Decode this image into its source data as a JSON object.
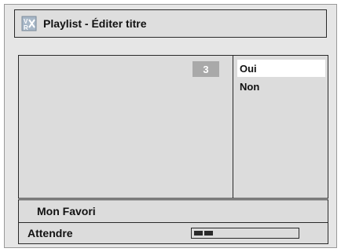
{
  "window": {
    "title": "Playlist - Éditer titre",
    "icon": "playlist-edit-icon"
  },
  "preview": {
    "counter": "3"
  },
  "menu": {
    "items": [
      {
        "label": "Oui",
        "selected": true
      },
      {
        "label": "Non",
        "selected": false
      }
    ]
  },
  "favorite": {
    "label": "Mon Favori"
  },
  "status": {
    "label": "Attendre",
    "progress": 0.18
  },
  "colors": {
    "background": "#e6e6e6",
    "panel": "#dcdcdc",
    "counter_bg": "#a9a9a9",
    "selected_bg": "#ffffff",
    "border": "#2a2a2a"
  }
}
